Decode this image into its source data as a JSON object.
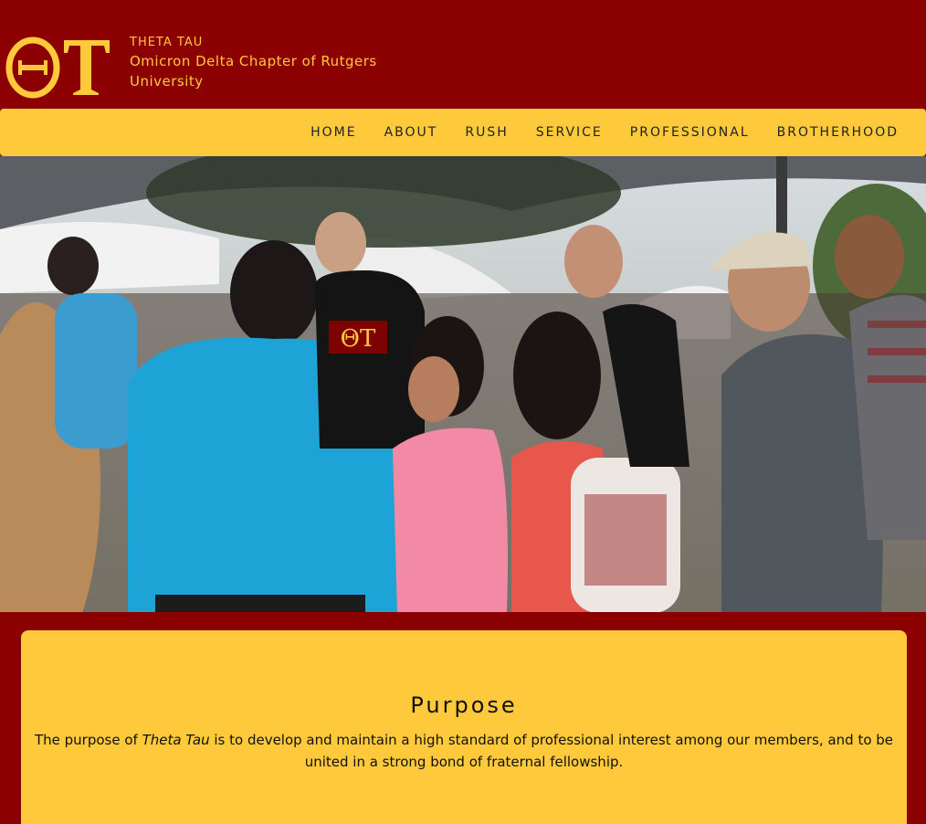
{
  "header": {
    "logo_glyphs": "ΘT",
    "org_name": "THETA TAU",
    "chapter_name": "Omicron Delta Chapter of Rutgers University"
  },
  "nav": {
    "items": [
      "HOME",
      "ABOUT",
      "RUSH",
      "SERVICE",
      "PROFESSIONAL",
      "BROTHERHOOD"
    ]
  },
  "hero": {
    "image_shirt_letters": "ΘT"
  },
  "purpose": {
    "title": "Purpose",
    "text_before": "The purpose of ",
    "text_emphasis": "Theta Tau",
    "text_after": " is to develop and maintain a high standard of professional interest among our members, and to be united in a strong bond of fraternal fellowship."
  },
  "colors": {
    "maroon": "#8b0000",
    "gold": "#ffc93c"
  }
}
